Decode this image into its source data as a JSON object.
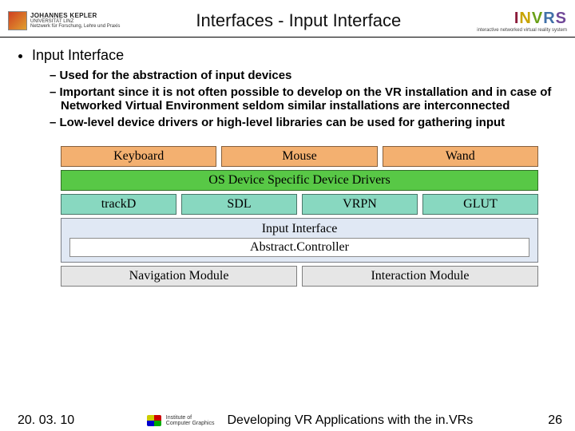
{
  "header": {
    "logo_left_main": "JOHANNES KEPLER",
    "logo_left_sub1": "UNIVERSITÄT LINZ",
    "logo_left_sub2": "Netzwerk für Forschung, Lehre und Praxis",
    "title": "Interfaces - Input Interface",
    "logo_right_main": "INVRS",
    "logo_right_sub": "interactive networked virtual reality system"
  },
  "bullets": {
    "main": "Input Interface",
    "subs": [
      "Used for the abstraction of input devices",
      "Important since it is not often possible to develop on the VR installation and in case of Networked Virtual Environment seldom similar installations are interconnected",
      "Low-level device drivers or high-level libraries can be used for gathering input"
    ]
  },
  "diagram": {
    "row1": [
      "Keyboard",
      "Mouse",
      "Wand"
    ],
    "row2": "OS Device Specific Device Drivers",
    "row3": [
      "trackD",
      "SDL",
      "VRPN",
      "GLUT"
    ],
    "row4_outer": "Input Interface",
    "row4_inner": "Abstract.Controller",
    "row5": [
      "Navigation Module",
      "Interaction Module"
    ]
  },
  "footer": {
    "date": "20. 03. 10",
    "mini_inst": "Institute of\nComputer Graphics",
    "talk": "Developing VR Applications with the in.VRs",
    "page": "26"
  }
}
